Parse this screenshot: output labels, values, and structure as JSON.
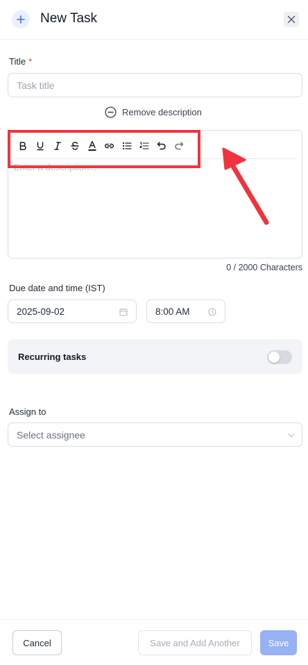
{
  "header": {
    "title": "New Task"
  },
  "title_field": {
    "label": "Title",
    "required_mark": "*",
    "placeholder": "Task title"
  },
  "description": {
    "remove_label": "Remove description",
    "placeholder": "Enter a description...",
    "char_count": "0 / 2000 Characters",
    "toolbar": [
      "bold",
      "underline",
      "italic",
      "strikethrough",
      "text-color",
      "link",
      "bullet-list",
      "numbered-list",
      "undo",
      "redo"
    ]
  },
  "due": {
    "label": "Due date and time (IST)",
    "date": "2025-09-02",
    "time": "8:00 AM"
  },
  "recurring": {
    "label": "Recurring tasks",
    "enabled": false
  },
  "assign": {
    "label": "Assign to",
    "placeholder": "Select assignee"
  },
  "footer": {
    "cancel": "Cancel",
    "save_another": "Save and Add Another",
    "save": "Save"
  },
  "colors": {
    "accent": "#96b2f4",
    "highlight": "#f2333e",
    "required": "#e53935"
  }
}
